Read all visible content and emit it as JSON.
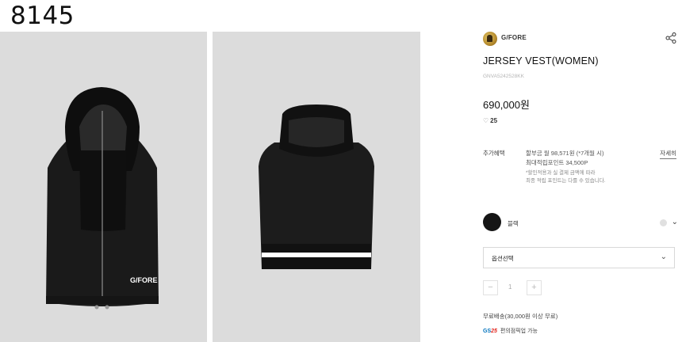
{
  "corner_code": "8145",
  "brand": {
    "name": "G/FORE",
    "logo_icon": "brand-logo-icon"
  },
  "product": {
    "title": "JERSEY VEST(WOMEN)",
    "code": "GNVA5242528KK",
    "price": "690,000원",
    "likes": "25",
    "vest_print": "G/FORE"
  },
  "benefits": {
    "label": "추가혜택",
    "installment": "할부금 월 98,571원 (*7개월 시)",
    "points": "최대적립포인트 34,500P",
    "note_line1": "*할인적용과 실 결제 금액에 따라",
    "note_line2": "최종 적립 포인트는 다를 수 있습니다.",
    "detail_link": "자세히"
  },
  "color": {
    "name": "블랙",
    "swatch": "#151515"
  },
  "option_select": {
    "label": "옵션선택"
  },
  "quantity": {
    "minus": "−",
    "value": "1",
    "plus": "+"
  },
  "shipping": "무료배송(30,000원 이상 무료)",
  "gs": {
    "logo_gs": "GS",
    "logo_25": "25",
    "text": "편의점픽업 가능"
  }
}
